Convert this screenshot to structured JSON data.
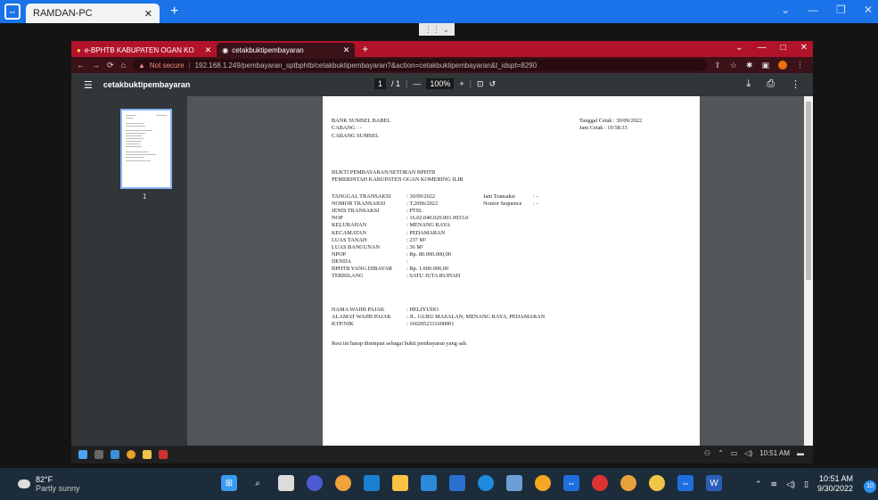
{
  "remote_window": {
    "tab_title": "RAMDAN-PC"
  },
  "browser": {
    "tabs": [
      {
        "label": "e-BPHTB KABUPATEN OGAN KO",
        "active": false
      },
      {
        "label": "cetakbuktipembayaran",
        "active": true
      }
    ],
    "address": {
      "security": "Not secure",
      "url": "192.168.1.249/pembayaran_sptbphtb/cetakbuktipembayaran?&action=cetakbuktipembayaran&t_idspt=8290"
    }
  },
  "pdf_viewer": {
    "title": "cetakbuktipembayaran",
    "current_page": "1",
    "total_pages": "/ 1",
    "zoom": "100%",
    "thumb_number": "1"
  },
  "document": {
    "bank": "BANK SUMSEL BABEL",
    "cabang": "CABANG : -",
    "cabang_name": "CABANG SUMSEL",
    "tanggal_cetak": "Tanggal Cetak : 30/09/2022",
    "jam_cetak": "Jam Cetak : 10:58:33",
    "heading1": "BUKTI PEMBAYARAN/SETORAN BPHTB",
    "heading2": "PEMERINTAH KABUPATEN OGAN KOMERING ILIR",
    "jam_transaksi_label": "Jam Transaksi",
    "jam_transaksi_value": ": -",
    "nomor_sequence_label": "Nomor Sequence",
    "nomor_sequence_value": ": -",
    "fields": [
      {
        "label": "TANGGAL TRANSAKSI",
        "value": ": 30/09/2022"
      },
      {
        "label": "NOMOR TRANSAKSI",
        "value": ": T.2096/2022"
      },
      {
        "label": "JENIS TRANSAKSI",
        "value": ": PTSL"
      },
      {
        "label": "NOP",
        "value": ": 16.02.040.020.001.0933.0"
      },
      {
        "label": "KELURAHAN",
        "value": ": MENANG RAYA"
      },
      {
        "label": "KECAMATAN",
        "value": ": PEDAMARAN"
      },
      {
        "label": "LUAS TANAH",
        "value": ": 237 M²"
      },
      {
        "label": "LUAS BANGUNAN",
        "value": ": 36 M²"
      },
      {
        "label": "NPOP",
        "value": ": Rp. 80.000.000,00"
      },
      {
        "label": "DENDA",
        "value": ":"
      },
      {
        "label": "BPHTB YANG DIBAYAR",
        "value": ": Rp. 1.000.000,00"
      },
      {
        "label": "TERBILANG",
        "value": ": SATU JUTA RUPIAH"
      }
    ],
    "wp_fields": [
      {
        "label": "NAMA WAJIB PAJAK",
        "value": ": HELIYUDO"
      },
      {
        "label": "ALAMAT WAJIB PAJAK",
        "value": ": JL. GURU MASALAN, MENANG RAYA, PEDAMARAN"
      },
      {
        "label": "KTP/NIK",
        "value": ": 1602052311690001"
      }
    ],
    "note": "Resi ini harap disimpan sebagai bukti pembayaran yang sah."
  },
  "inner_taskbar": {
    "time": "10:51 AM"
  },
  "taskbar": {
    "temperature": "82°F",
    "weather": "Partly sunny",
    "time": "10:51 AM",
    "date": "9/30/2022",
    "notification_count": "10"
  }
}
